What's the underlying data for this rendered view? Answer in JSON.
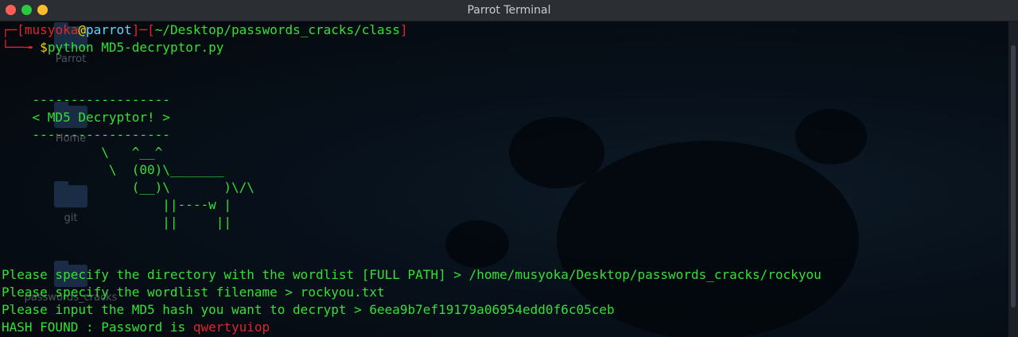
{
  "window": {
    "title": "Parrot Terminal"
  },
  "desktop_icons": [
    {
      "label": "Parrot"
    },
    {
      "label": "Home"
    },
    {
      "label": "git"
    },
    {
      "label": "passwords_cracks"
    }
  ],
  "prompt": {
    "corner_top": "┌─",
    "bracket_open": "[",
    "user": "musyoka",
    "at": "@",
    "host": "parrot",
    "bracket_close": "]",
    "dash": "─",
    "path_bracket_open": "[",
    "path": "~/Desktop/passwords_cracks/class",
    "path_bracket_close": "]",
    "corner_bottom": "└──╼ ",
    "dollar": "$",
    "command": "python MD5-decryptor.py"
  },
  "banner": [
    "    ------------------",
    "    < MD5 Decryptor! >",
    "    ------------------",
    "             \\   ^__^",
    "              \\  (00)\\_______",
    "                 (__)\\       )\\/\\",
    "                     ||----w |",
    "                     ||     ||"
  ],
  "output": {
    "dir_prompt": "Please specify the directory with the wordlist [FULL PATH] > /home/musyoka/Desktop/passwords_cracks/rockyou",
    "file_prompt": "Please specify the wordlist filename > rockyou.txt",
    "hash_prompt": "Please input the MD5 hash you want to decrypt > 6eea9b7ef19179a06954edd0f6c05ceb",
    "found_label": "HASH FOUND : Password is ",
    "password": "qwertyuiop"
  },
  "colors": {
    "terminal_green": "#33e033",
    "prompt_red": "#e0262c",
    "host_cyan": "#5fd7ff",
    "dollar_yellow": "#f5d300"
  }
}
